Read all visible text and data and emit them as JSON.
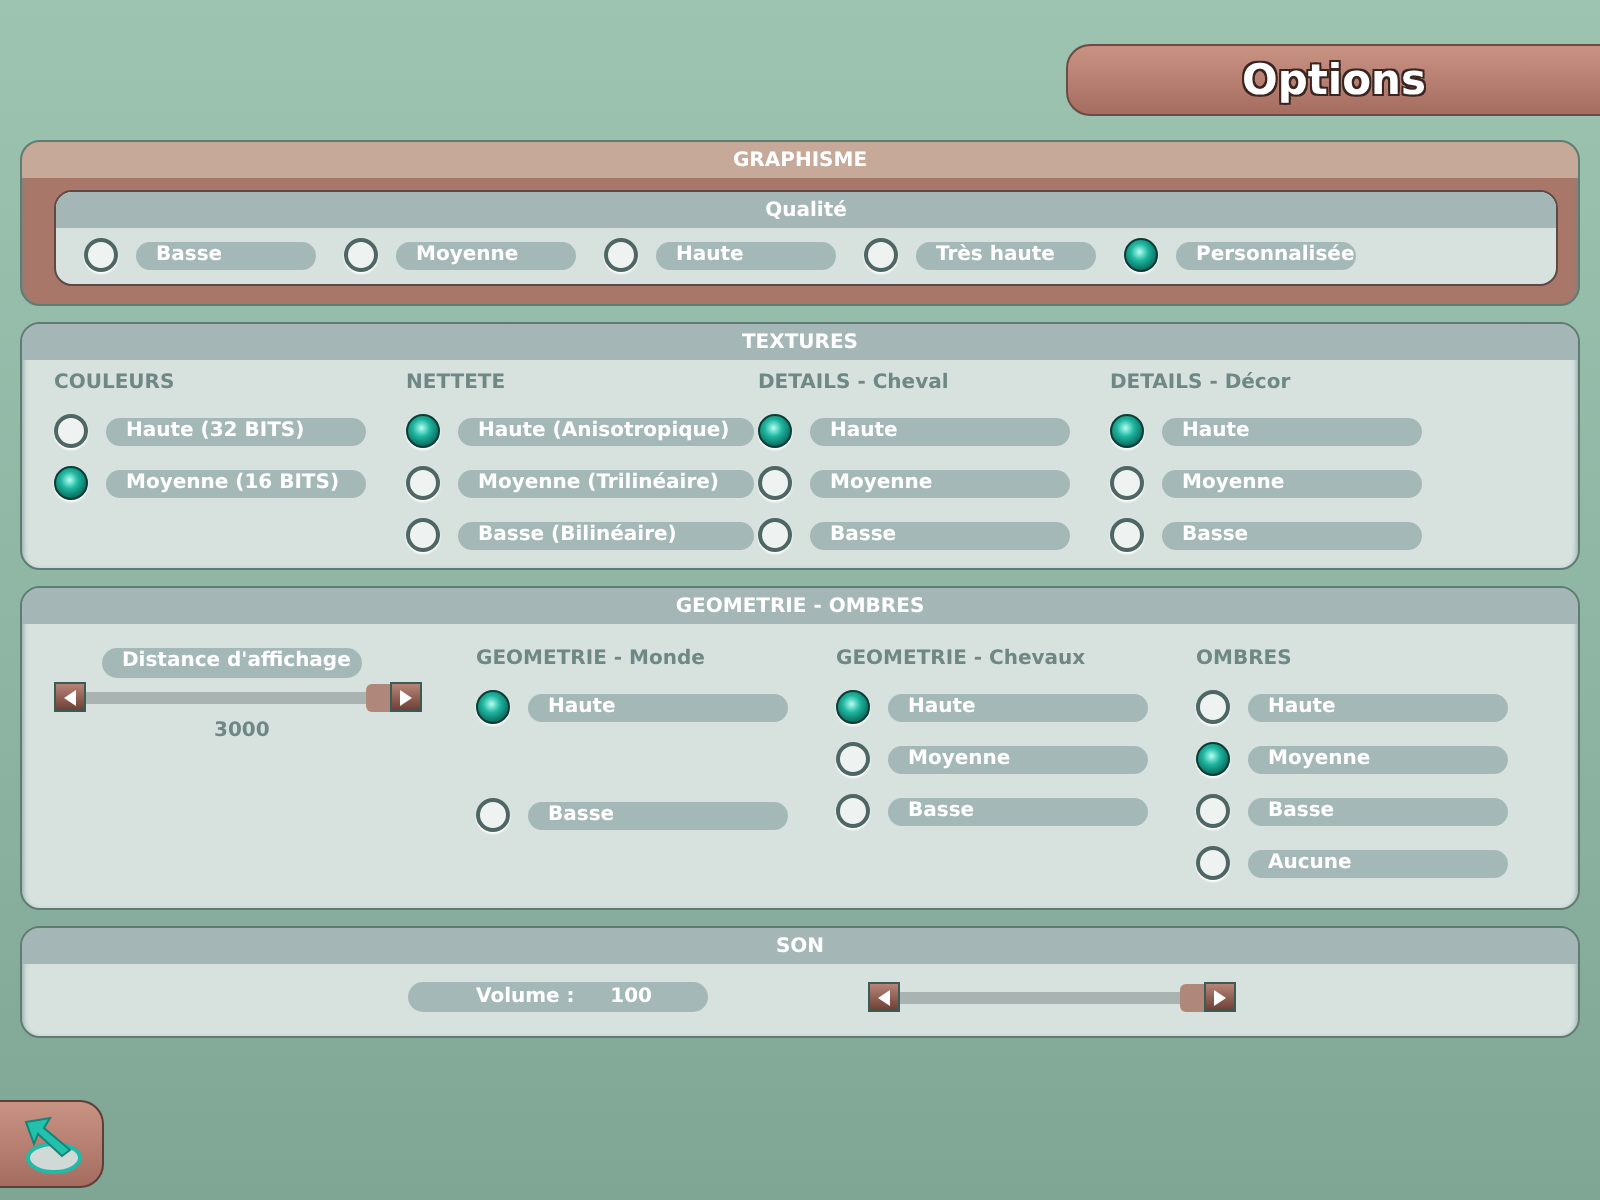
{
  "title": "Options",
  "graphisme": {
    "title": "GRAPHISME",
    "subtitle": "Qualité",
    "options": [
      {
        "label": "Basse",
        "selected": false
      },
      {
        "label": "Moyenne",
        "selected": false
      },
      {
        "label": "Haute",
        "selected": false
      },
      {
        "label": "Très haute",
        "selected": false
      },
      {
        "label": "Personnalisée",
        "selected": true
      }
    ]
  },
  "textures": {
    "title": "TEXTURES",
    "groups": [
      {
        "heading": "COULEURS",
        "options": [
          {
            "label": "Haute (32 BITS)",
            "selected": false
          },
          {
            "label": "Moyenne (16 BITS)",
            "selected": true
          }
        ]
      },
      {
        "heading": "NETTETE",
        "options": [
          {
            "label": "Haute (Anisotropique)",
            "selected": true
          },
          {
            "label": "Moyenne (Trilinéaire)",
            "selected": false
          },
          {
            "label": "Basse (Bilinéaire)",
            "selected": false
          }
        ]
      },
      {
        "heading": "DETAILS - Cheval",
        "options": [
          {
            "label": "Haute",
            "selected": true
          },
          {
            "label": "Moyenne",
            "selected": false
          },
          {
            "label": "Basse",
            "selected": false
          }
        ]
      },
      {
        "heading": "DETAILS - Décor",
        "options": [
          {
            "label": "Haute",
            "selected": true
          },
          {
            "label": "Moyenne",
            "selected": false
          },
          {
            "label": "Basse",
            "selected": false
          }
        ]
      }
    ]
  },
  "geometrie": {
    "title": "GEOMETRIE - OMBRES",
    "distance": {
      "label": "Distance d'affichage",
      "level": 1,
      "reading": "3000"
    },
    "groups": [
      {
        "heading": "GEOMETRIE - Monde",
        "spread": true,
        "options": [
          {
            "label": "Haute",
            "selected": true
          },
          {
            "label": "Basse",
            "selected": false
          }
        ]
      },
      {
        "heading": "GEOMETRIE - Chevaux",
        "spread": false,
        "options": [
          {
            "label": "Haute",
            "selected": true
          },
          {
            "label": "Moyenne",
            "selected": false
          },
          {
            "label": "Basse",
            "selected": false
          }
        ]
      },
      {
        "heading": "OMBRES",
        "spread": false,
        "options": [
          {
            "label": "Haute",
            "selected": false
          },
          {
            "label": "Moyenne",
            "selected": true
          },
          {
            "label": "Basse",
            "selected": false
          },
          {
            "label": "Aucune",
            "selected": false
          }
        ]
      }
    ]
  },
  "son": {
    "title": "SON",
    "volume_label": "Volume :",
    "volume_value": "100",
    "level": 1
  }
}
